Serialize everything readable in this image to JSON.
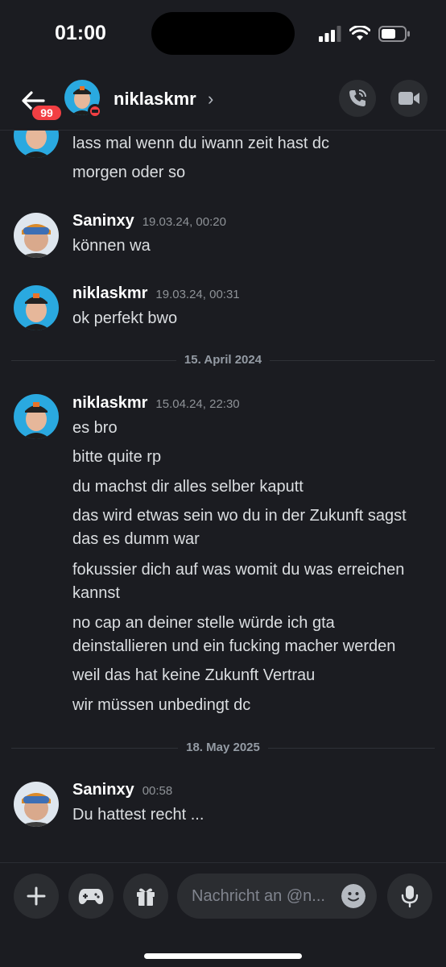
{
  "status_bar": {
    "time": "01:00"
  },
  "header": {
    "unread_badge": "99",
    "username": "niklaskmr"
  },
  "messages": {
    "g0": {
      "lines": [
        "lass mal wenn du iwann zeit hast dc",
        "morgen oder so"
      ]
    },
    "g1": {
      "author": "Saninxy",
      "time": "19.03.24, 00:20",
      "lines": [
        "können wa"
      ]
    },
    "g2": {
      "author": "niklaskmr",
      "time": "19.03.24, 00:31",
      "lines": [
        "ok perfekt bwo"
      ]
    },
    "divider1": "15. April 2024",
    "g3": {
      "author": "niklaskmr",
      "time": "15.04.24, 22:30",
      "lines": [
        "es bro",
        "bitte quite rp",
        "du machst dir alles selber kaputt",
        "das wird etwas sein wo du in der Zukunft sagst",
        "das es dumm war",
        "fokussier dich auf was womit du was erreichen",
        "kannst",
        "no cap an deiner stelle würde ich gta",
        "deinstallieren und ein fucking macher werden",
        "weil das hat keine Zukunft Vertrau",
        "wir müssen unbedingt dc"
      ]
    },
    "divider2": "18. May 2025",
    "g4": {
      "author": "Saninxy",
      "time": "00:58",
      "lines": [
        "Du hattest recht ..."
      ]
    }
  },
  "composer": {
    "placeholder": "Nachricht an @n..."
  },
  "colors": {
    "background": "#1b1c21",
    "surface": "#2b2d31",
    "dnd": "#f23f43",
    "text": "#dbdee1",
    "muted": "#8e9297"
  }
}
